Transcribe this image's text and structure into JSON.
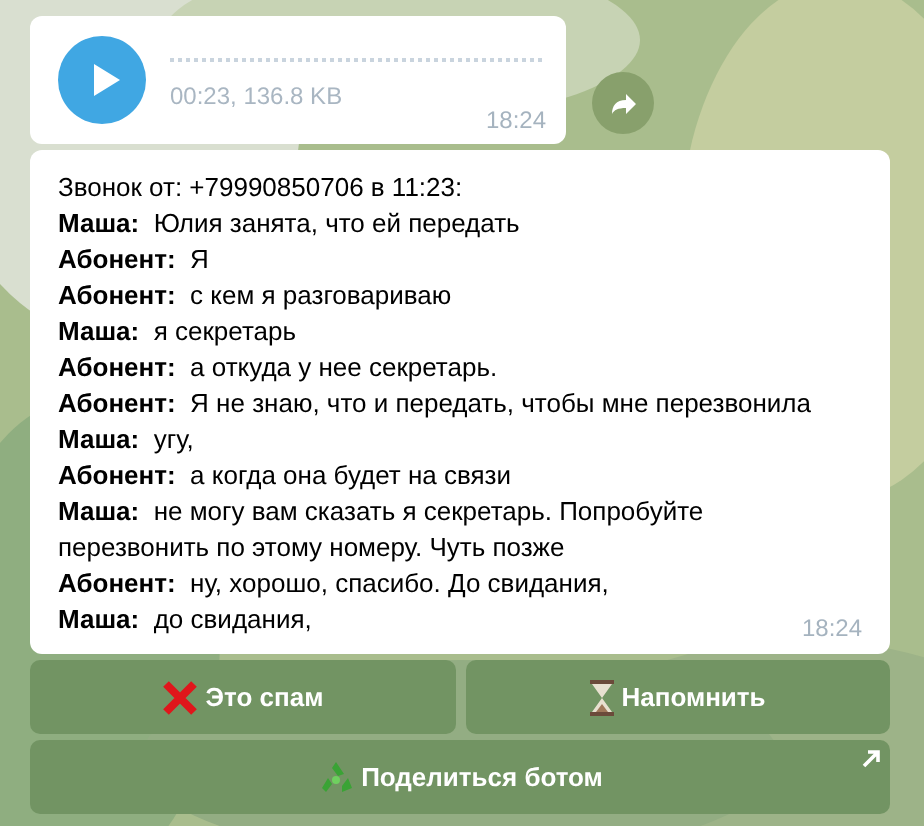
{
  "audio_message": {
    "info": "00:23, 136.8 KB",
    "time": "18:24"
  },
  "call_message": {
    "header": "Звонок от: +79990850706 в 11:23:",
    "lines": [
      {
        "speaker": "Маша:",
        "text": "Юлия занята, что ей передать"
      },
      {
        "speaker": "Абонент:",
        "text": "Я"
      },
      {
        "speaker": "Абонент:",
        "text": "с кем я разговариваю"
      },
      {
        "speaker": "Маша:",
        "text": "я секретарь"
      },
      {
        "speaker": "Абонент:",
        "text": "а откуда у нее секретарь."
      },
      {
        "speaker": "Абонент:",
        "text": "Я не знаю, что и передать, чтобы мне перезвонила"
      },
      {
        "speaker": "Маша:",
        "text": "угу,"
      },
      {
        "speaker": "Абонент:",
        "text": "а когда она будет на связи"
      },
      {
        "speaker": "Маша:",
        "text": "не могу вам сказать я секретарь. Попробуйте перезвонить по этому номеру. Чуть позже"
      },
      {
        "speaker": "Абонент:",
        "text": "ну, хорошо, спасибо. До свидания,"
      },
      {
        "speaker": "Маша:",
        "text": "до свидания,"
      }
    ],
    "time": "18:24"
  },
  "keyboard": [
    [
      {
        "label": "Это спам",
        "kind": "spam"
      },
      {
        "label": "Напомнить",
        "kind": "remind"
      }
    ],
    [
      {
        "label": "Поделиться ботом",
        "kind": "share",
        "external": true
      }
    ]
  ]
}
